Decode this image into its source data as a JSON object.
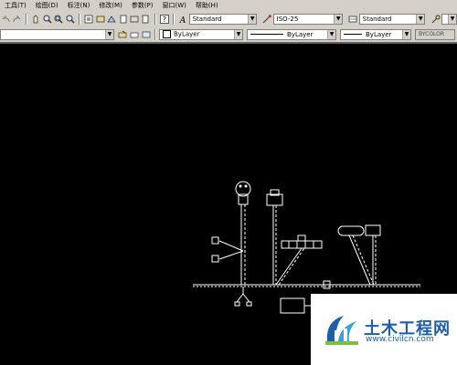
{
  "menu": [
    "工具(T)",
    "绘图(D)",
    "标注(N)",
    "修改(M)",
    "参数(P)",
    "窗口(W)",
    "帮助(H)"
  ],
  "styles": {
    "text_style": "Standard",
    "dim_style": "ISO-25",
    "table_style": "Standard"
  },
  "properties": {
    "color": "ByLayer",
    "linetype": "ByLayer",
    "lineweight": "ByLayer",
    "plot_style": "BYCOLOR"
  },
  "watermark": {
    "name": "土木工程网",
    "url": "www.civilcn.com"
  },
  "colors": {
    "background": "#000000",
    "lines": "#ffffff",
    "brand": "#1d5fa8"
  }
}
